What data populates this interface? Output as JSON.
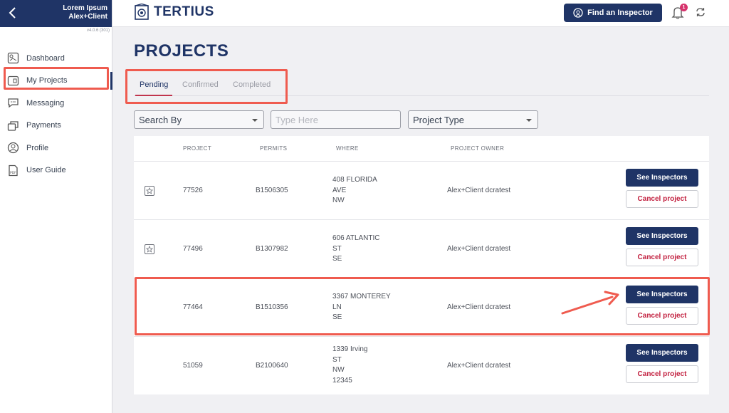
{
  "sidebar": {
    "user_line1": "Lorem Ipsum",
    "user_line2": "Alex+Client",
    "version": "v4.0.6 (301)",
    "items": [
      {
        "label": "Dashboard",
        "icon": "dashboard-icon"
      },
      {
        "label": "My Projects",
        "icon": "projects-icon"
      },
      {
        "label": "Messaging",
        "icon": "messaging-icon"
      },
      {
        "label": "Payments",
        "icon": "payments-icon"
      },
      {
        "label": "Profile",
        "icon": "profile-icon"
      },
      {
        "label": "User Guide",
        "icon": "pdf-icon"
      }
    ],
    "active_item": "My Projects"
  },
  "header": {
    "brand": "TERTIUS",
    "find_button": "Find an Inspector",
    "notification_count": "1"
  },
  "page": {
    "title": "PROJECTS",
    "tabs": [
      "Pending",
      "Confirmed",
      "Completed"
    ],
    "active_tab": "Pending"
  },
  "filters": {
    "search_by": "Search By",
    "search_placeholder": "Type Here",
    "project_type": "Project Type"
  },
  "table": {
    "headers": [
      "PROJECT",
      "PERMITS",
      "WHERE",
      "PROJECT OWNER"
    ],
    "rows": [
      {
        "project": "77526",
        "permit": "B1506305",
        "where": [
          "408 FLORIDA",
          "AVE",
          "NW"
        ],
        "owner": "Alex+Client dcratest",
        "see": "See Inspectors",
        "cancel": "Cancel project"
      },
      {
        "project": "77496",
        "permit": "B1307982",
        "where": [
          "606 ATLANTIC",
          "ST",
          "SE"
        ],
        "owner": "Alex+Client dcratest",
        "see": "See Inspectors",
        "cancel": "Cancel project"
      },
      {
        "project": "77464",
        "permit": "B1510356",
        "where": [
          "3367 MONTEREY",
          "LN",
          "SE"
        ],
        "owner": "Alex+Client dcratest",
        "see": "See Inspectors",
        "cancel": "Cancel project"
      },
      {
        "project": "51059",
        "permit": "B2100640",
        "where": [
          "1339 Irving",
          "ST",
          "NW",
          "12345"
        ],
        "owner": "Alex+Client dcratest",
        "see": "See Inspectors",
        "cancel": "Cancel project"
      }
    ]
  },
  "colors": {
    "navy": "#1f3466",
    "annotation": "#ef5b4f",
    "cancel_text": "#c2203f"
  }
}
